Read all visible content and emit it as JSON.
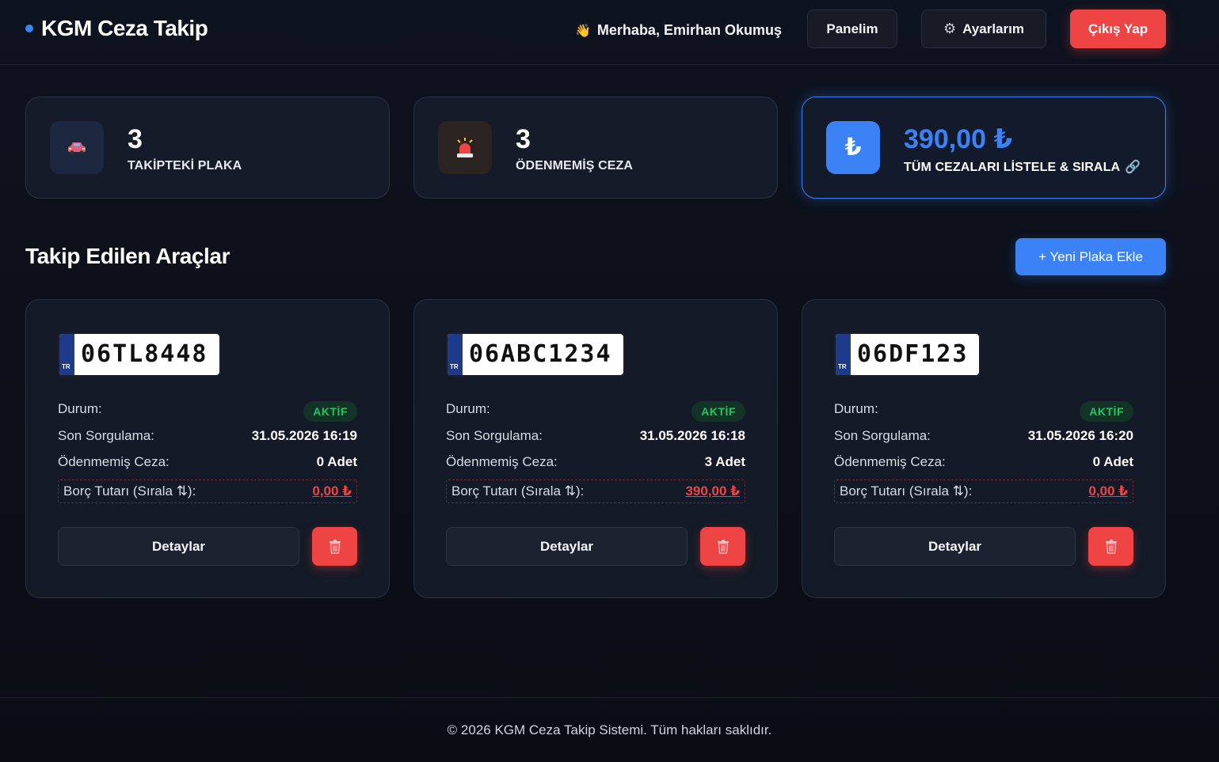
{
  "header": {
    "brand": "KGM Ceza Takip",
    "greeting_prefix": "Merhaba,",
    "user_name": "Emirhan Okumuş",
    "nav": {
      "panel": "Panelim",
      "settings": "Ayarlarım",
      "logout": "Çıkış Yap"
    }
  },
  "stats": [
    {
      "value": "3",
      "label": "TAKİPTEKİ PLAKA",
      "icon": "car-icon"
    },
    {
      "value": "3",
      "label": "ÖDENMEMİŞ CEZA",
      "icon": "siren-icon"
    },
    {
      "value": "390,00 ₺",
      "label": "TÜM CEZALARI LİSTELE & SIRALA",
      "icon": "lira-icon",
      "icon_glyph": "₺"
    }
  ],
  "section": {
    "title": "Takip Edilen Araçlar",
    "add_button": "+ Yeni Plaka Ekle"
  },
  "labels": {
    "status": "Durum:",
    "last_query": "Son Sorgulama:",
    "unpaid": "Ödenmemiş Ceza:",
    "debt": "Borç Tutarı (Sırala ⇅):",
    "details": "Detaylar",
    "plate_country": "TR"
  },
  "vehicles": [
    {
      "plate": "06TL8448",
      "status": "AKTİF",
      "last_query": "31.05.2026 16:19",
      "unpaid": "0 Adet",
      "debt": "0,00 ₺"
    },
    {
      "plate": "06ABC1234",
      "status": "AKTİF",
      "last_query": "31.05.2026 16:18",
      "unpaid": "3 Adet",
      "debt": "390,00 ₺"
    },
    {
      "plate": "06DF123",
      "status": "AKTİF",
      "last_query": "31.05.2026 16:20",
      "unpaid": "0 Adet",
      "debt": "0,00 ₺"
    }
  ],
  "footer": {
    "text": "© 2026 KGM Ceza Takip Sistemi. Tüm hakları saklıdır."
  },
  "colors": {
    "accent": "#3b82f6",
    "danger": "#ef4444",
    "success": "#22c55e",
    "background": "#0e1320",
    "card": "#151b28"
  }
}
